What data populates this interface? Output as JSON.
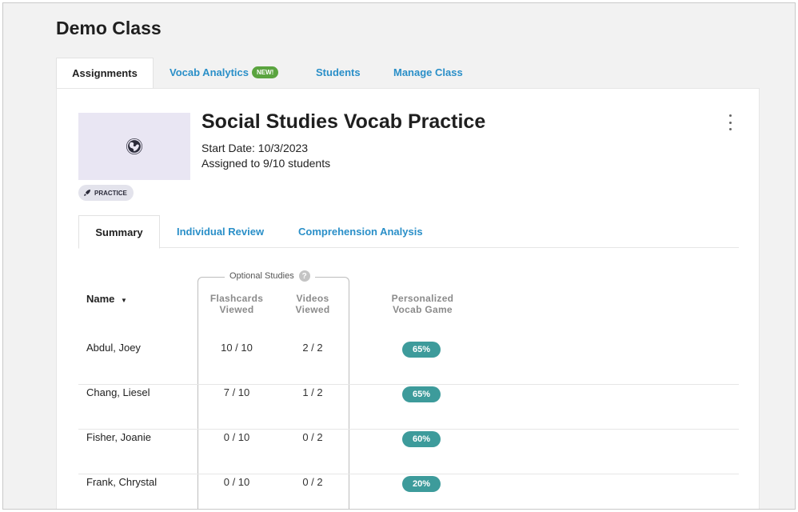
{
  "header": {
    "class_title": "Demo Class"
  },
  "main_tabs": [
    {
      "label": "Assignments",
      "active": true
    },
    {
      "label": "Vocab Analytics",
      "badge": "NEW!"
    },
    {
      "label": "Students"
    },
    {
      "label": "Manage Class"
    }
  ],
  "assignment": {
    "title": "Social Studies Vocab Practice",
    "start_date": "Start Date: 10/3/2023",
    "assigned": "Assigned to 9/10 students",
    "badge": "PRACTICE",
    "icon": "globe-icon",
    "accent_color": "#2b2b3a"
  },
  "sub_tabs": [
    {
      "label": "Summary",
      "active": true
    },
    {
      "label": "Individual Review"
    },
    {
      "label": "Comprehension Analysis"
    }
  ],
  "table": {
    "optional_label": "Optional Studies",
    "headers": {
      "name": "Name",
      "flashcards": [
        "Flashcards",
        "Viewed"
      ],
      "videos": [
        "Videos",
        "Viewed"
      ],
      "game": [
        "Personalized",
        "Vocab Game"
      ]
    },
    "rows": [
      {
        "name": "Abdul, Joey",
        "flashcards": "10 / 10",
        "videos": "2 / 2",
        "score": "65%"
      },
      {
        "name": "Chang, Liesel",
        "flashcards": "7 / 10",
        "videos": "1 / 2",
        "score": "65%"
      },
      {
        "name": "Fisher, Joanie",
        "flashcards": "0 / 10",
        "videos": "0 / 2",
        "score": "60%"
      },
      {
        "name": "Frank, Chrystal",
        "flashcards": "0 / 10",
        "videos": "0 / 2",
        "score": "20%"
      }
    ]
  },
  "colors": {
    "link": "#2a8fc8",
    "score_pill": "#3d9b9b",
    "new_badge": "#5aa43f"
  }
}
